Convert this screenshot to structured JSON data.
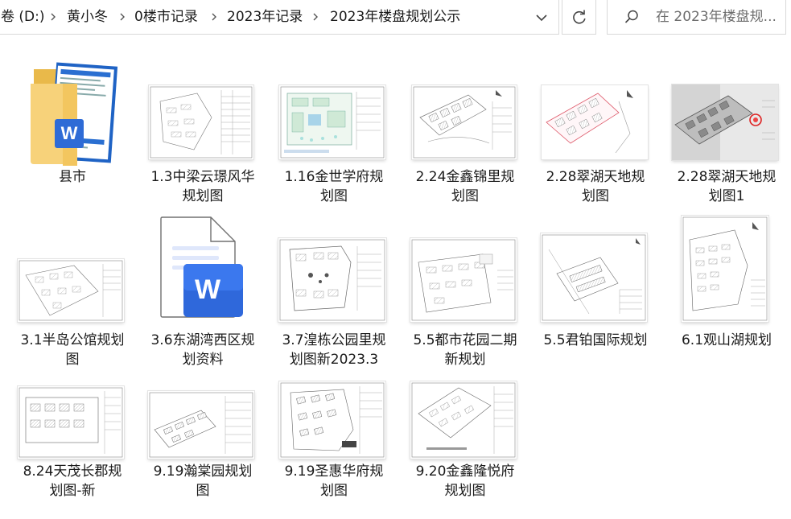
{
  "address": {
    "crumbs": [
      "卷 (D:)",
      "黄小冬",
      "0楼市记录",
      "2023年记录",
      "2023年楼盘规划公示"
    ],
    "dropdown_icon": "chevron-down-icon",
    "refresh_icon": "refresh-icon"
  },
  "search": {
    "placeholder": "在 2023年楼盘规...",
    "icon": "search-icon"
  },
  "items": [
    {
      "name": "县市",
      "lines": [
        "县市"
      ],
      "kind": "folder"
    },
    {
      "name": "1.3中梁云璟风华规划图",
      "lines": [
        "1.3中梁云璟风华",
        "规划图"
      ],
      "kind": "plan"
    },
    {
      "name": "1.16金世学府规划图",
      "lines": [
        "1.16金世学府规",
        "划图"
      ],
      "kind": "plan"
    },
    {
      "name": "2.24金鑫锦里规划图",
      "lines": [
        "2.24金鑫锦里规",
        "划图"
      ],
      "kind": "plan"
    },
    {
      "name": "2.28翠湖天地规划图",
      "lines": [
        "2.28翠湖天地规",
        "划图"
      ],
      "kind": "plan"
    },
    {
      "name": "2.28翠湖天地规划图1",
      "lines": [
        "2.28翠湖天地规",
        "划图1"
      ],
      "kind": "photo"
    },
    {
      "name": "3.1半岛公馆规划图",
      "lines": [
        "3.1半岛公馆规划",
        "图"
      ],
      "kind": "plan"
    },
    {
      "name": "3.6东湖湾西区规划资料",
      "lines": [
        "3.6东湖湾西区规",
        "划资料"
      ],
      "kind": "word"
    },
    {
      "name": "3.7湟栋公园里规划图新2023.3",
      "lines": [
        "3.7湟栋公园里规",
        "划图新2023.3"
      ],
      "kind": "plan"
    },
    {
      "name": "5.5都市花园二期新规划",
      "lines": [
        "5.5都市花园二期",
        "新规划"
      ],
      "kind": "plan"
    },
    {
      "name": "5.5君铂国际规划",
      "lines": [
        "5.5君铂国际规划"
      ],
      "kind": "plan"
    },
    {
      "name": "6.1观山湖规划",
      "lines": [
        "6.1观山湖规划"
      ],
      "kind": "plan"
    },
    {
      "name": "8.24天茂长郡规划图-新",
      "lines": [
        "8.24天茂长郡规",
        "划图-新"
      ],
      "kind": "plan"
    },
    {
      "name": "9.19瀚棠园规划图",
      "lines": [
        "9.19瀚棠园规划",
        "图"
      ],
      "kind": "plan"
    },
    {
      "name": "9.19圣惠华府规划图",
      "lines": [
        "9.19圣惠华府规",
        "划图"
      ],
      "kind": "plan"
    },
    {
      "name": "9.20金鑫隆悦府规划图",
      "lines": [
        "9.20金鑫隆悦府",
        "规划图"
      ],
      "kind": "plan"
    }
  ],
  "word_badge": "W"
}
